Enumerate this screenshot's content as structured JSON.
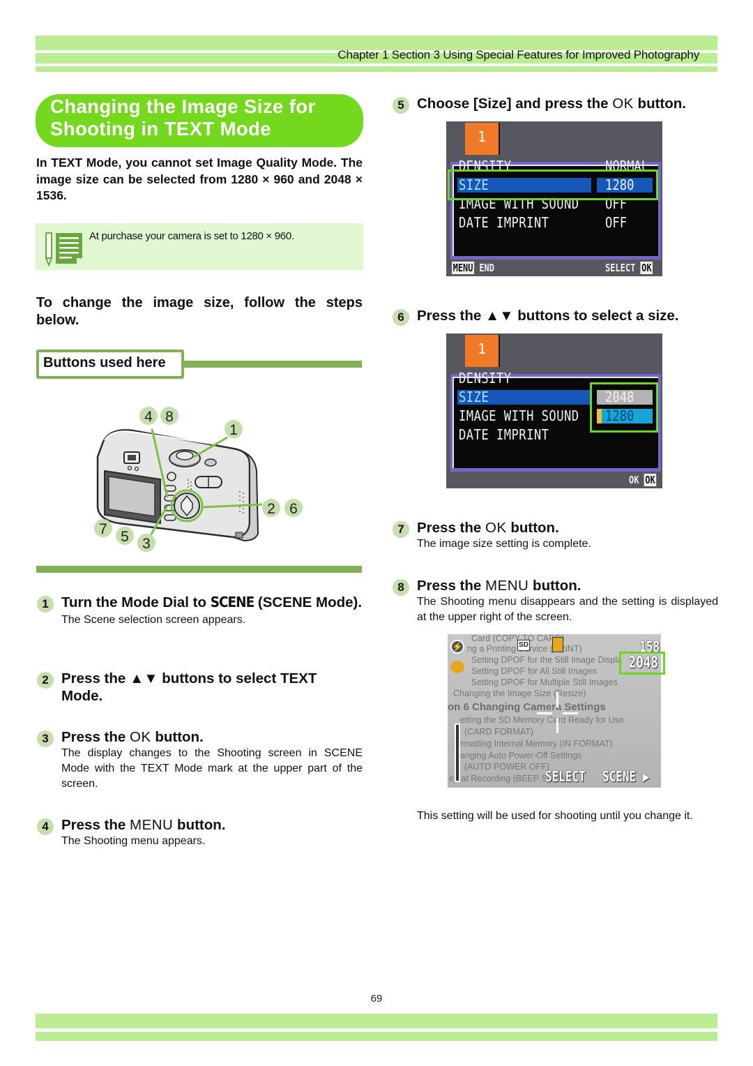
{
  "header": {
    "chapter_text": "Chapter 1 Section 3 Using Special Features for Improved Photography"
  },
  "title": {
    "line1": "Changing the Image Size for",
    "line2": "Shooting in TEXT Mode"
  },
  "intro": "In TEXT Mode, you cannot set Image Quality Mode. The image size can be selected from 1280 × 960 and 2048 × 1536.",
  "note": {
    "icon": "memo-pencil-icon",
    "text": "At purchase your camera is set to 1280 × 960."
  },
  "lead": "To change the image size, follow the steps below.",
  "buttons_used": {
    "label": "Buttons used here",
    "callouts": [
      "4",
      "8",
      "1",
      "2",
      "6",
      "7",
      "5",
      "3"
    ]
  },
  "steps_left": [
    {
      "num": "1",
      "head_a": "Turn the Mode Dial to ",
      "head_b": "SCENE",
      "head_c": " (SCENE Mode).",
      "body": "The Scene selection screen appears."
    },
    {
      "num": "2",
      "head_a": "Press the ▲▼ buttons to select TEXT Mode.",
      "body": ""
    },
    {
      "num": "3",
      "head_a": "Press the ",
      "head_b": "OK",
      "head_c": " button.",
      "body": "The display changes to the Shooting screen in SCENE Mode with the TEXT Mode mark at the upper part of the screen."
    },
    {
      "num": "4",
      "head_a": "Press the ",
      "head_b": "MENU",
      "head_c": " button.",
      "body": "The Shooting menu appears."
    }
  ],
  "steps_right": [
    {
      "num": "5",
      "head_a": "Choose [Size] and press the ",
      "head_b": "OK",
      "head_c": " button."
    },
    {
      "num": "6",
      "head_a": "Press the ▲▼ buttons to select a size."
    },
    {
      "num": "7",
      "head_a": "Press the ",
      "head_b": "OK",
      "head_c": " button.",
      "body": "The image size setting is complete."
    },
    {
      "num": "8",
      "head_a": "Press the ",
      "head_b": "MENU",
      "head_c": " button.",
      "body": "The Shooting menu disappears and the setting is displayed at the upper right of the screen."
    }
  ],
  "screen1": {
    "tab": "1",
    "rows": [
      {
        "label": "DENSITY",
        "value": "NORMAL"
      },
      {
        "label": "SIZE",
        "value": "1280"
      },
      {
        "label": "IMAGE WITH SOUND",
        "value": "OFF"
      },
      {
        "label": "DATE IMPRINT",
        "value": "OFF"
      }
    ],
    "footer_left_key": "MENU",
    "footer_left": "END",
    "footer_right": "SELECT",
    "footer_right_key": "OK"
  },
  "screen2": {
    "tab": "1",
    "rows": [
      "DENSITY",
      "SIZE",
      "IMAGE WITH SOUND",
      "DATE IMPRINT"
    ],
    "options": [
      "2048",
      "1280"
    ],
    "footer_right": "OK",
    "footer_right_key": "OK"
  },
  "screen3": {
    "remaining_shots": "158",
    "size": "2048",
    "bottom_left": "SELECT",
    "bottom_right": "SCENE ▶",
    "background_lines": [
      "Card (COPY TO CARD)",
      "ng a Printing Service (PRINT)",
      "Setting DPOF for the Still Image Displa",
      "Setting DPOF for All Still Images",
      "Setting DPOF for Multiple Still Images",
      "Changing the Image Size (Resize)",
      "on 6  Changing Camera Settings",
      "etting the SD Memory Card Ready for Use",
      "(CARD FORMAT)",
      "rmatting Internal Memory (IN FORMAT)",
      "anging Auto Power-Off Settings",
      "(AUTO POWER OFF)",
      "ep at Recording (BEEP SOUND)"
    ]
  },
  "closing": "This setting will be used for shooting until you change it.",
  "page_number": "69"
}
